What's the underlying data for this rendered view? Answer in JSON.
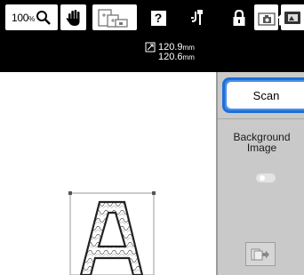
{
  "statusbar": {
    "icons": [
      "wifi-icon",
      "camera-icon",
      "gear-icon",
      "help-icon",
      "needle-icon",
      "lock-icon",
      "home-icon"
    ],
    "help_label": "?"
  },
  "toolbar": {
    "zoom_value": "100",
    "zoom_unit": "%",
    "width_value": "120.9",
    "height_value": "120.6",
    "unit": "mm"
  },
  "side_panel": {
    "scan_label": "Scan",
    "background_line1": "Background",
    "background_line2": "Image",
    "background_toggle": "off"
  },
  "canvas": {
    "pattern_letter": "A"
  },
  "colors": {
    "accent": "#1e6fd9",
    "bar": "#000000",
    "panel": "#c9c9c9"
  }
}
